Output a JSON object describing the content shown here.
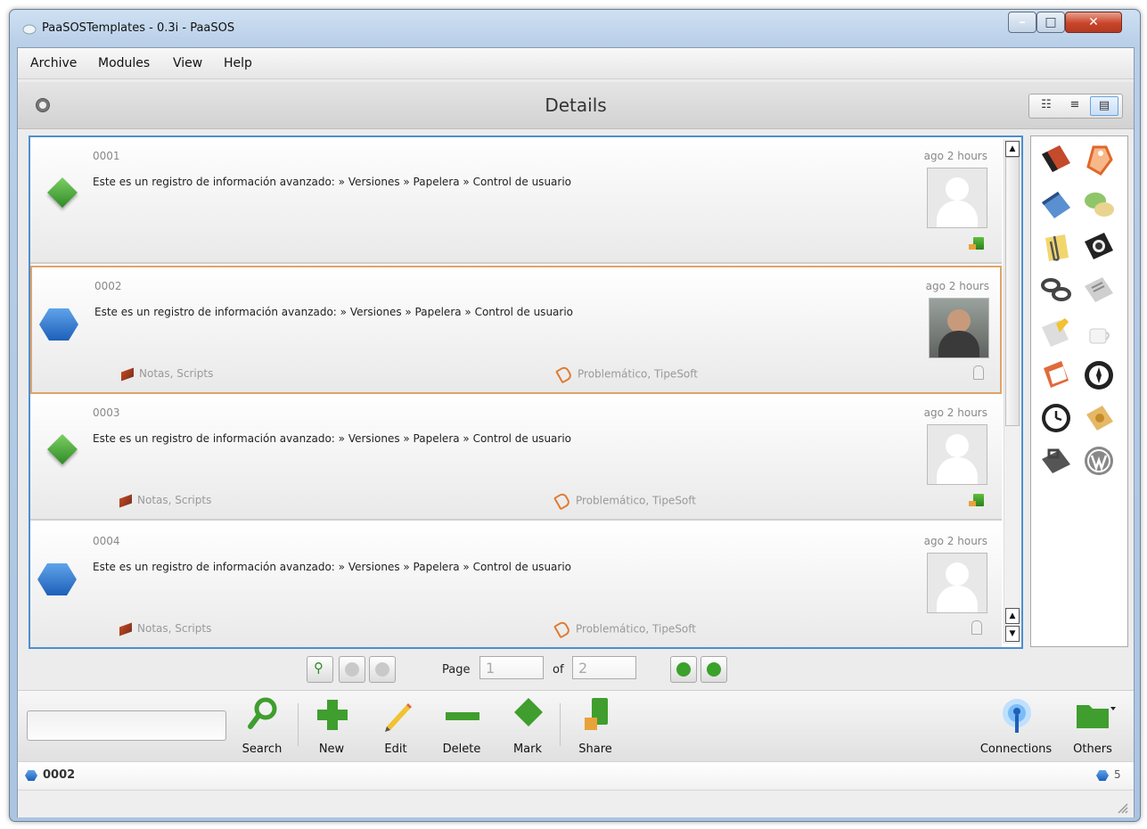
{
  "window": {
    "title": "PaaSOSTemplates - 0.3i - PaaSOS"
  },
  "menu": {
    "items": [
      "Archive",
      "Modules",
      "View",
      "Help"
    ]
  },
  "header": {
    "title": "Details"
  },
  "records": [
    {
      "id": "0001",
      "text": "Este es un registro de información avanzado: » Versiones » Papelera » Control de usuario",
      "time": "ago 2 hours",
      "notes": "",
      "tags": "",
      "shape": "diamond",
      "status": "share"
    },
    {
      "id": "0002",
      "text": "Este es un registro de información avanzado: » Versiones » Papelera » Control de usuario",
      "time": "ago 2 hours",
      "notes": "Notas, Scripts",
      "tags": "Problemático, TipeSoft",
      "shape": "hexagon",
      "status": "lock"
    },
    {
      "id": "0003",
      "text": "Este es un registro de información avanzado: » Versiones » Papelera » Control de usuario",
      "time": "ago 2 hours",
      "notes": "Notas, Scripts",
      "tags": "Problemático, TipeSoft",
      "shape": "diamond",
      "status": "share"
    },
    {
      "id": "0004",
      "text": "Este es un registro de información avanzado: » Versiones » Papelera » Control de usuario",
      "time": "ago 2 hours",
      "notes": "Notas, Scripts",
      "tags": "Problemático, TipeSoft",
      "shape": "hexagon",
      "status": "lock"
    }
  ],
  "palette": {
    "icons": [
      "floppy-disk-icon",
      "tag-icon",
      "notepad-icon",
      "chat-icon",
      "paperclip-icon",
      "camera-icon",
      "chain-link-icon",
      "newspaper-icon",
      "document-edit-icon",
      "coffee-cup-icon",
      "notes-flag-icon",
      "compass-icon",
      "clock-icon",
      "address-book-icon",
      "toolbox-icon",
      "wordpress-icon"
    ]
  },
  "pager": {
    "page_label": "Page",
    "page_value": "1",
    "of_label": "of",
    "total_pages": "2"
  },
  "toolbar": {
    "search_value": "",
    "search": "Search",
    "new": "New",
    "edit": "Edit",
    "delete": "Delete",
    "mark": "Mark",
    "share": "Share",
    "connections": "Connections",
    "others": "Others"
  },
  "status": {
    "selected": "0002",
    "count": "5"
  },
  "colors": {
    "accent": "#4d8ed0",
    "selected_border": "#e0a36a",
    "green": "#3f9e2e",
    "blue": "#1e5fb8"
  }
}
